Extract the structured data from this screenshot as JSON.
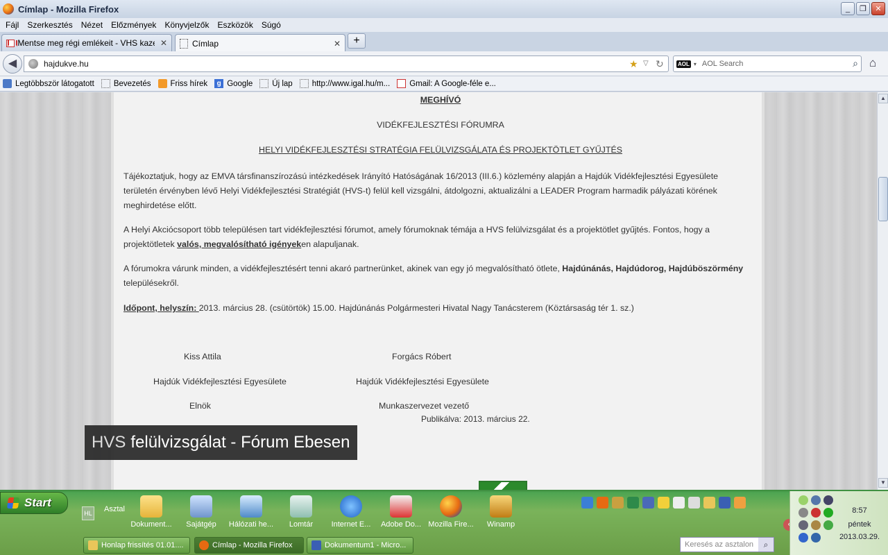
{
  "window": {
    "title": "Címlap - Mozilla Firefox"
  },
  "menu": [
    "Fájl",
    "Szerkesztés",
    "Nézet",
    "Előzmények",
    "Könyvjelzők",
    "Eszközök",
    "Súgó"
  ],
  "tabs": [
    {
      "label": "Mentse meg régi emlékeit - VHS kazettár...",
      "icon": "gmail-icon"
    },
    {
      "label": "Címlap",
      "icon": "blank-page-icon"
    }
  ],
  "nav": {
    "url": "hajdukve.hu",
    "search_placeholder": "AOL Search"
  },
  "bookmarks": [
    "Legtöbbször látogatott",
    "Bevezetés",
    "Friss hírek",
    "Google",
    "Új lap",
    "http://www.igal.hu/m...",
    "Gmail: A Google-féle e..."
  ],
  "content": {
    "heading": "MEGHÍVÓ",
    "subheading": "VIDÉKFEJLESZTÉSI FÓRUMRA",
    "topic": "HELYI VIDÉKFEJLESZTÉSI STRATÉGIA FELÜLVIZSGÁLATA ÉS PROJEKTÖTLET GYŰJTÉS",
    "p1": "Tájékoztatjuk, hogy az EMVA társfinanszírozású intézkedések Irányító Hatóságának 16/2013 (III.6.) közlemény alapján a Hajdúk Vidékfejlesztési Egyesülete területén érvényben lévő Helyi Vidékfejlesztési Stratégiát (HVS-t) felül kell vizsgálni, átdolgozni, aktualizálni a LEADER Program harmadik pályázati körének meghirdetése előtt.",
    "p2_a": "A Helyi Akciócsoport több településen tart vidékfejlesztési fórumot, amely fórumoknak témája a HVS felülvizsgálat és a projektötlet gyűjtés. Fontos, hogy a projektötletek ",
    "p2_b": "valós, megvalósítható igények",
    "p2_c": "en alapuljanak.",
    "p3_a": "A fórumokra várunk minden, a vidékfejlesztésért tenni akaró partnerünket, akinek van egy jó megvalósítható ötlete, ",
    "p3_b": "Hajdúnánás, Hajdúdorog, Hajdúböszörmény",
    "p3_c": " településekről.",
    "p4_label": "Időpont, helyszín: ",
    "p4_text": "2013. március 28. (csütörtök) 15.00. Hajdúnánás Polgármesteri Hivatal Nagy Tanácsterem (Köztársaság tér 1. sz.)",
    "sig_left_name": "Kiss Attila",
    "sig_left_org": "Hajdúk Vidékfejlesztési Egyesülete",
    "sig_left_role": "Elnök",
    "sig_right_name": "Forgács Róbert",
    "sig_right_org": "Hajdúk Vidékfejlesztési Egyesülete",
    "sig_right_role": "Munkaszervezet vezető",
    "published": "Publikálva: 2013. március 22.",
    "caption_thin": "HVS",
    "caption_bold": "felülvizsgálat - Fórum Ebesen"
  },
  "taskbar": {
    "start": "Start",
    "quicklaunch_label": "Asztal",
    "hl": "HL",
    "apps": [
      "Dokument...",
      "Sajátgép",
      "Hálózati he...",
      "Lomtár",
      "Internet E...",
      "Adobe Do...",
      "Mozilla Fire...",
      "Winamp"
    ],
    "tasks": [
      "Honlap frissítés 01.01....",
      "Címlap - Mozilla Firefox",
      "Dokumentum1 - Micro..."
    ],
    "desk_search": "Keresés az asztalon",
    "clock_time": "8:57",
    "clock_day": "péntek",
    "clock_date": "2013.03.29."
  }
}
